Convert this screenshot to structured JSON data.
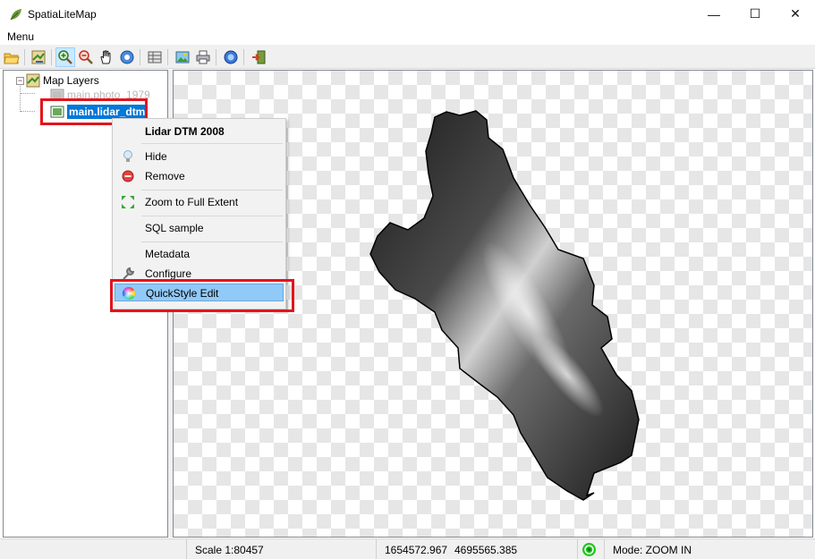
{
  "window": {
    "title": "SpatiaLiteMap",
    "controls": {
      "minimize": "—",
      "maximize": "☐",
      "close": "✕"
    }
  },
  "menubar": {
    "items": [
      {
        "label": "Menu"
      }
    ]
  },
  "toolbar": {
    "buttons": [
      {
        "icon": "folder-open-icon"
      },
      {
        "icon": "layers-map-icon"
      },
      {
        "icon": "zoom-in-icon",
        "active": true
      },
      {
        "icon": "zoom-out-icon"
      },
      {
        "icon": "pan-hand-icon"
      },
      {
        "icon": "identify-icon"
      },
      {
        "icon": "table-icon"
      },
      {
        "icon": "image-export-icon"
      },
      {
        "icon": "print-icon"
      },
      {
        "icon": "info-icon"
      },
      {
        "icon": "exit-icon"
      }
    ]
  },
  "tree": {
    "root_label": "Map Layers",
    "expander": "−",
    "layers": [
      {
        "label": "main.photo_1979",
        "visible": false
      },
      {
        "label": "main.lidar_dtm",
        "selected": true
      }
    ]
  },
  "context_menu": {
    "title": "Lidar DTM 2008",
    "items": [
      {
        "label": "Hide",
        "icon": "lightbulb-icon"
      },
      {
        "label": "Remove",
        "icon": "remove-icon"
      },
      {
        "label": "Zoom to Full Extent",
        "icon": "full-extent-icon"
      },
      {
        "label": "SQL sample",
        "icon": ""
      },
      {
        "label": "Metadata",
        "icon": ""
      },
      {
        "label": "Configure",
        "icon": "wrench-icon"
      },
      {
        "label": "QuickStyle Edit",
        "icon": "color-wheel-icon",
        "hovered": true
      }
    ]
  },
  "statusbar": {
    "scale": "Scale 1:80457",
    "x": "1654572.967",
    "y": "4695565.385",
    "mode": "Mode: ZOOM IN"
  },
  "colors": {
    "selection": "#0078d7",
    "highlight_box": "#e3141c",
    "menu_hover": "#91c9f7",
    "status_led": "#1ec81e"
  }
}
